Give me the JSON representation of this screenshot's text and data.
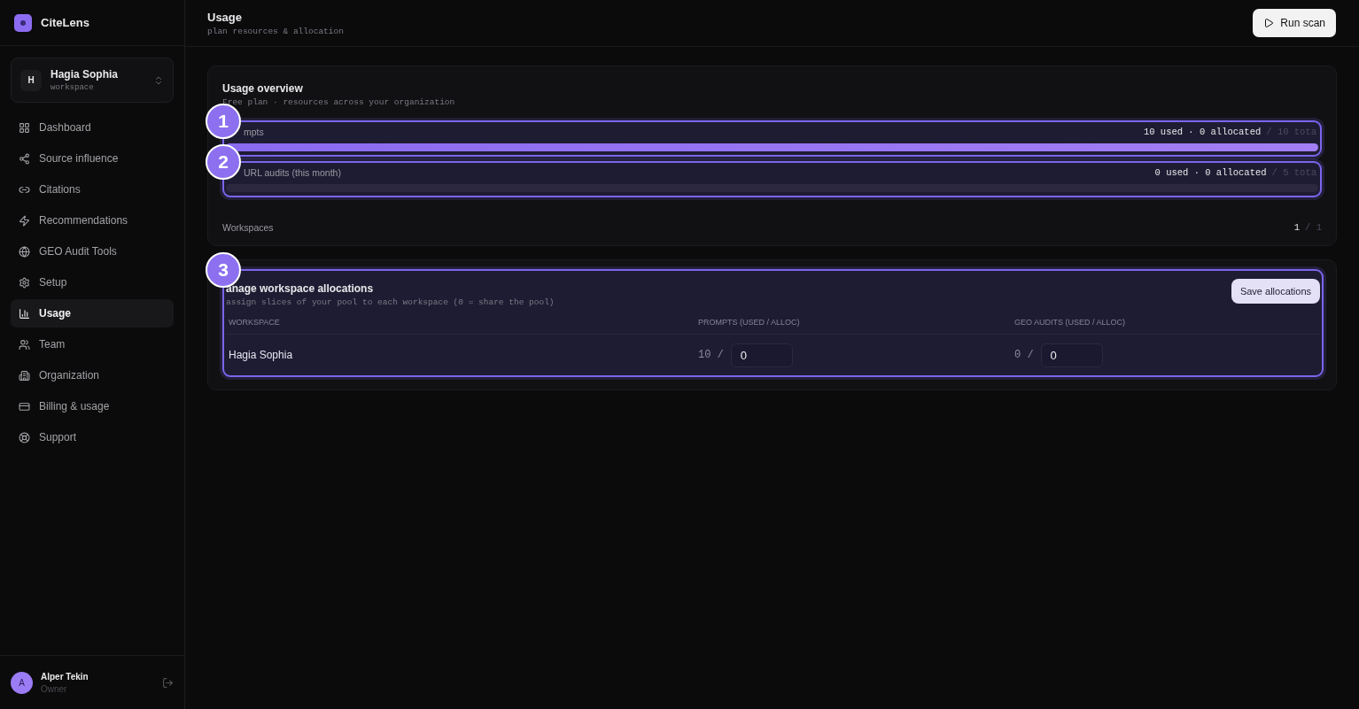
{
  "brand": {
    "name": "CiteLens"
  },
  "workspace_switcher": {
    "initial": "H",
    "name": "Hagia Sophia",
    "subtitle": "workspace"
  },
  "nav": [
    {
      "label": "Dashboard",
      "selected": false
    },
    {
      "label": "Source influence",
      "selected": false
    },
    {
      "label": "Citations",
      "selected": false
    },
    {
      "label": "Recommendations",
      "selected": false
    },
    {
      "label": "GEO Audit Tools",
      "selected": false
    },
    {
      "label": "Setup",
      "selected": false
    },
    {
      "label": "Usage",
      "selected": true
    },
    {
      "label": "Team",
      "selected": false
    },
    {
      "label": "Organization",
      "selected": false
    },
    {
      "label": "Billing & usage",
      "selected": false
    },
    {
      "label": "Support",
      "selected": false
    }
  ],
  "user": {
    "initial": "A",
    "name": "Alper Tekin",
    "role": "Owner"
  },
  "header": {
    "title": "Usage",
    "subtitle": "plan resources & allocation",
    "action": "Run scan"
  },
  "overview": {
    "title": "Usage overview",
    "subtitle": "Free plan · resources across your organization",
    "metrics": [
      {
        "label": "mpts",
        "used": "10 used · 0 allocated",
        "total": "/ 10 tota",
        "level": 1,
        "callout": "1"
      },
      {
        "label": "URL audits (this month)",
        "used": "0 used · 0 allocated",
        "total": "/ 5 tota",
        "level": 0,
        "callout": "2"
      }
    ],
    "workspaces": {
      "label": "Workspaces",
      "used": "1",
      "total": "/ 1"
    }
  },
  "allocations": {
    "title": "anage workspace allocations",
    "subtitle": "assign slices of your pool to each workspace (0 = share the pool)",
    "action": "Save allocations",
    "callout": "3",
    "columns": [
      "WORKSPACE",
      "PROMPTS (USED / ALLOC)",
      "GEO AUDITS (USED / ALLOC)"
    ],
    "rows": [
      {
        "workspace": "Hagia Sophia",
        "prompts_used": "10 /",
        "prompts_alloc": "0",
        "geo_used": "0 /",
        "geo_alloc": "0"
      }
    ]
  }
}
